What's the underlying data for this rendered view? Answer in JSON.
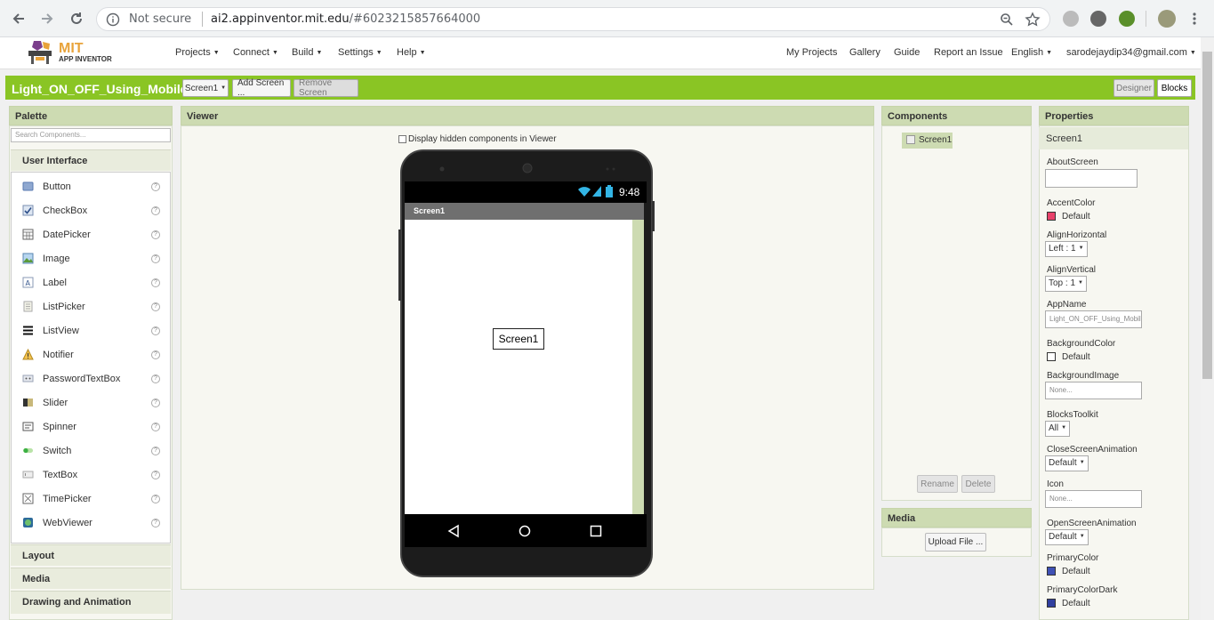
{
  "browser": {
    "security_label": "Not secure",
    "url_host": "ai2.appinventor.mit.edu",
    "url_path": "/#6023215857664000"
  },
  "app": {
    "logo_mit": "MIT",
    "logo_sub": "APP INVENTOR",
    "menu_left": [
      "Projects",
      "Connect",
      "Build",
      "Settings",
      "Help"
    ],
    "menu_right": [
      "My Projects",
      "Gallery",
      "Guide",
      "Report an Issue",
      "English",
      "sarodejaydip34@gmail.com"
    ]
  },
  "projectbar": {
    "title": "Light_ON_OFF_Using_Mobile",
    "screen_select": "Screen1",
    "add_screen": "Add Screen ...",
    "remove_screen": "Remove Screen",
    "designer": "Designer",
    "blocks": "Blocks"
  },
  "palette": {
    "title": "Palette",
    "search_placeholder": "Search Components...",
    "open_category": "User Interface",
    "items": [
      "Button",
      "CheckBox",
      "DatePicker",
      "Image",
      "Label",
      "ListPicker",
      "ListView",
      "Notifier",
      "PasswordTextBox",
      "Slider",
      "Spinner",
      "Switch",
      "TextBox",
      "TimePicker",
      "WebViewer"
    ],
    "help_glyph": "?",
    "categories_below": [
      "Layout",
      "Media",
      "Drawing and Animation"
    ]
  },
  "viewer": {
    "title": "Viewer",
    "hidden_checkbox": "Display hidden components in Viewer",
    "phone_time": "9:48",
    "phone_title": "Screen1",
    "screen_label": "Screen1"
  },
  "components": {
    "title": "Components",
    "tree_item": "Screen1",
    "rename": "Rename",
    "delete": "Delete"
  },
  "media": {
    "title": "Media",
    "upload": "Upload File ..."
  },
  "properties": {
    "title": "Properties",
    "selected": "Screen1",
    "about_label": "AboutScreen",
    "accent_label": "AccentColor",
    "accent_value": "Default",
    "accent_color": "#e8416a",
    "alignh_label": "AlignHorizontal",
    "alignh_value": "Left : 1",
    "alignv_label": "AlignVertical",
    "alignv_value": "Top : 1",
    "appname_label": "AppName",
    "appname_value": "Light_ON_OFF_Using_Mobile",
    "bgcolor_label": "BackgroundColor",
    "bgcolor_value": "Default",
    "bgimage_label": "BackgroundImage",
    "bgimage_value": "None...",
    "blocks_label": "BlocksToolkit",
    "blocks_value": "All",
    "close_anim_label": "CloseScreenAnimation",
    "close_anim_value": "Default",
    "icon_label": "Icon",
    "icon_value": "None...",
    "open_anim_label": "OpenScreenAnimation",
    "open_anim_value": "Default",
    "primary_label": "PrimaryColor",
    "primary_value": "Default",
    "primary_color": "#3f51b5",
    "primarydark_label": "PrimaryColorDark",
    "primarydark_value": "Default",
    "primarydark_color": "#303f9f"
  }
}
